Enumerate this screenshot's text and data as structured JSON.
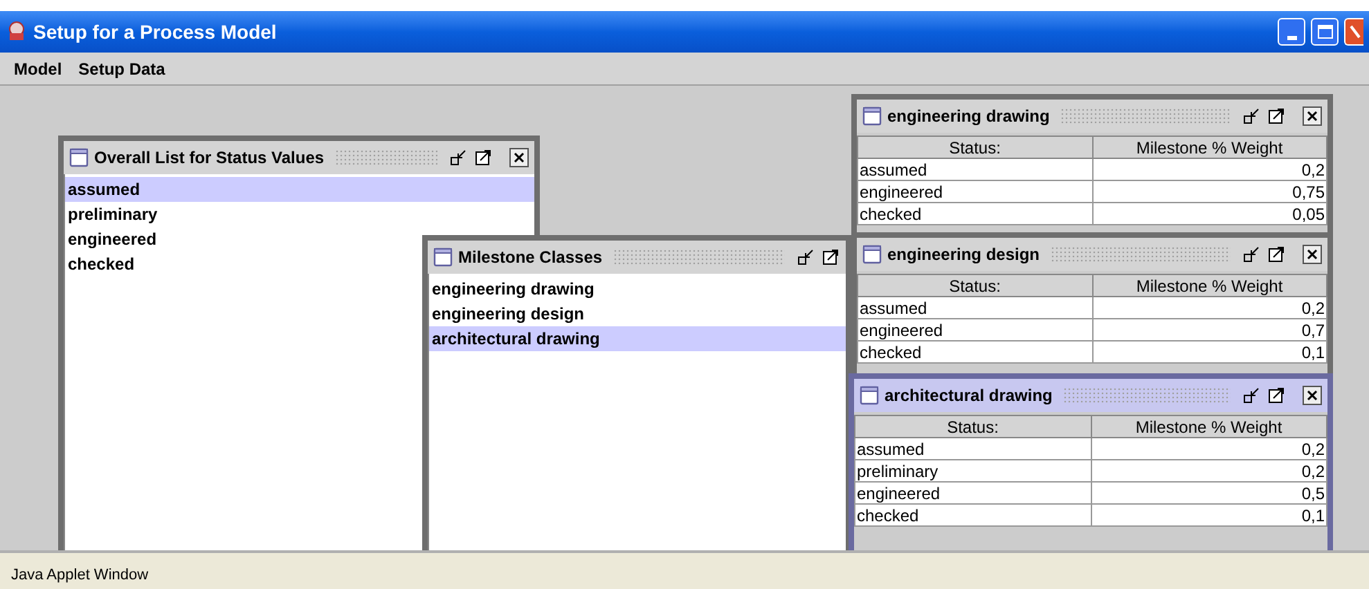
{
  "window": {
    "title": "Setup for a Process Model"
  },
  "menu": [
    "Model",
    "Setup Data"
  ],
  "frames": [
    {
      "kind": "list",
      "title": "Overall List for Status Values",
      "active": false,
      "items": [
        {
          "label": "assumed",
          "selected": true
        },
        {
          "label": "preliminary",
          "selected": false
        },
        {
          "label": "engineered",
          "selected": false
        },
        {
          "label": "checked",
          "selected": false
        }
      ]
    },
    {
      "kind": "list",
      "title": "Milestone Classes",
      "active": false,
      "items": [
        {
          "label": "engineering drawing",
          "selected": false
        },
        {
          "label": "engineering design",
          "selected": false
        },
        {
          "label": "architectural drawing",
          "selected": true
        }
      ]
    },
    {
      "kind": "table",
      "title": "engineering drawing",
      "active": false,
      "columns": [
        "Status:",
        "Milestone % Weight"
      ],
      "rows": [
        [
          "assumed",
          "0,2"
        ],
        [
          "engineered",
          "0,75"
        ],
        [
          "checked",
          "0,05"
        ]
      ]
    },
    {
      "kind": "table",
      "title": "engineering design",
      "active": false,
      "columns": [
        "Status:",
        "Milestone % Weight"
      ],
      "rows": [
        [
          "assumed",
          "0,2"
        ],
        [
          "engineered",
          "0,7"
        ],
        [
          "checked",
          "0,1"
        ]
      ]
    },
    {
      "kind": "table",
      "title": "architectural drawing",
      "active": true,
      "columns": [
        "Status:",
        "Milestone % Weight"
      ],
      "rows": [
        [
          "assumed",
          "0,2"
        ],
        [
          "preliminary",
          "0,2"
        ],
        [
          "engineered",
          "0,5"
        ],
        [
          "checked",
          "0,1"
        ]
      ]
    }
  ],
  "status_bar": "Java Applet Window"
}
